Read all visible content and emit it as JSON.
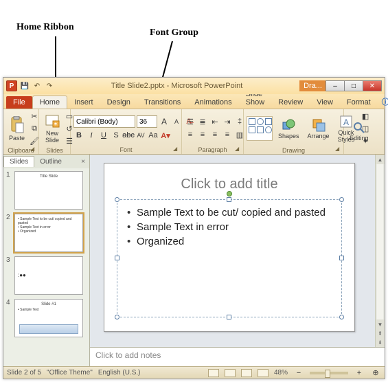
{
  "annotations": {
    "home": "Home Ribbon",
    "fontgroup": "Font Group"
  },
  "title": "Title Slide2.pptx - Microsoft PowerPoint",
  "contextual_tab": "Dra...",
  "tabs": {
    "file": "File",
    "home": "Home",
    "insert": "Insert",
    "design": "Design",
    "transitions": "Transitions",
    "animations": "Animations",
    "slideshow": "Slide Show",
    "review": "Review",
    "view": "View",
    "format": "Format"
  },
  "ribbon": {
    "clipboard": {
      "label": "Clipboard",
      "paste": "Paste"
    },
    "slides": {
      "label": "Slides",
      "newslide": "New\nSlide"
    },
    "font": {
      "label": "Font",
      "name": "Calibri (Body)",
      "size": "36",
      "grow": "A",
      "shrink": "A",
      "case": "Aa",
      "bold": "B",
      "italic": "I",
      "under": "U",
      "strike": "abc",
      "shadow": "S",
      "spacing": "AV",
      "clear": "A"
    },
    "paragraph": {
      "label": "Paragraph"
    },
    "drawing": {
      "label": "Drawing",
      "shapes": "Shapes",
      "arrange": "Arrange",
      "quick": "Quick\nStyles"
    },
    "editing": {
      "label": "Editing"
    }
  },
  "left_pane": {
    "tab_slides": "Slides",
    "tab_outline": "Outline",
    "thumbs": [
      {
        "num": "1",
        "title": "Title Slide",
        "lines": []
      },
      {
        "num": "2",
        "title": "",
        "lines": [
          "• Sample Text to be cut/ copied and pasted",
          "• Sample Text in error",
          "• Organized"
        ]
      },
      {
        "num": "3",
        "title": "",
        "lines": [
          ":●●"
        ]
      },
      {
        "num": "4",
        "title": "Slide #1",
        "lines": [
          "• Sample Text"
        ]
      }
    ]
  },
  "slide": {
    "title_placeholder": "Click to add title",
    "bullets": [
      "Sample Text to be cut/ copied and pasted",
      "Sample Text in error",
      "Organized"
    ]
  },
  "notes_placeholder": "Click to add notes",
  "status": {
    "slide_of": "Slide 2 of 5",
    "theme": "\"Office Theme\"",
    "lang": "English (U.S.)",
    "zoom": "48%",
    "fit": "⊕"
  }
}
